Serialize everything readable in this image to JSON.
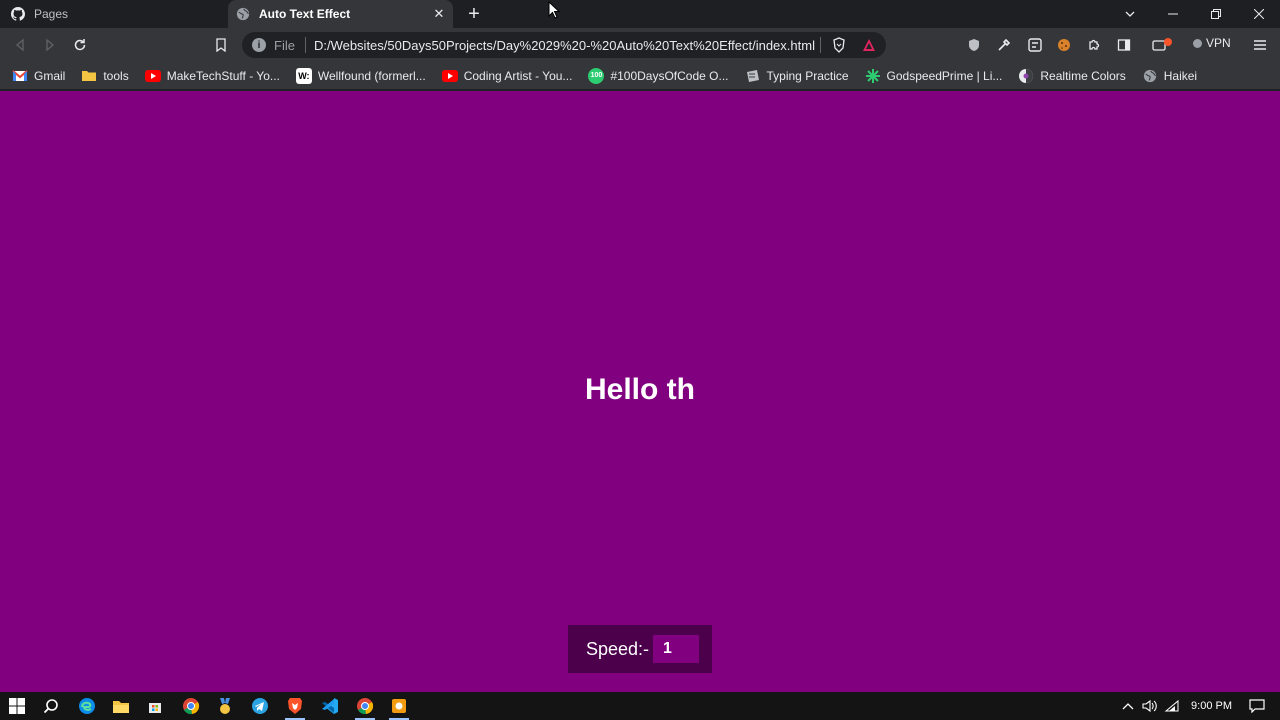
{
  "browser": {
    "tabs": [
      {
        "title": "Pages",
        "icon": "github-icon",
        "active": false
      },
      {
        "title": "Auto Text Effect",
        "icon": "globe-icon",
        "active": true
      }
    ],
    "address": {
      "scheme_label": "File",
      "url": "D:/Websites/50Days50Projects/Day%2029%20-%20Auto%20Text%20Effect/index.html"
    },
    "vpn_label": "VPN",
    "bookmarks": [
      {
        "label": "Gmail",
        "icon": "gmail-icon"
      },
      {
        "label": "tools",
        "icon": "folder-icon"
      },
      {
        "label": "MakeTechStuff - Yo...",
        "icon": "youtube-icon"
      },
      {
        "label": "Wellfound (formerl...",
        "icon": "wellfound-icon"
      },
      {
        "label": "Coding Artist - You...",
        "icon": "youtube-icon"
      },
      {
        "label": "#100DaysOfCode O...",
        "icon": "100days-icon"
      },
      {
        "label": "Typing Practice",
        "icon": "keyboard-icon"
      },
      {
        "label": "GodspeedPrime | Li...",
        "icon": "star-icon"
      },
      {
        "label": "Realtime Colors",
        "icon": "palette-icon"
      },
      {
        "label": "Haikei",
        "icon": "globe-icon"
      }
    ]
  },
  "page": {
    "background": "#800080",
    "auto_text": "Hello th",
    "speed": {
      "label": "Speed:-",
      "value": "1"
    }
  },
  "taskbar": {
    "clock": "9:00 PM"
  },
  "colors": {
    "accent_purple": "#800080",
    "dark_purple": "#4c004c",
    "brave_orange": "#fb542b"
  }
}
